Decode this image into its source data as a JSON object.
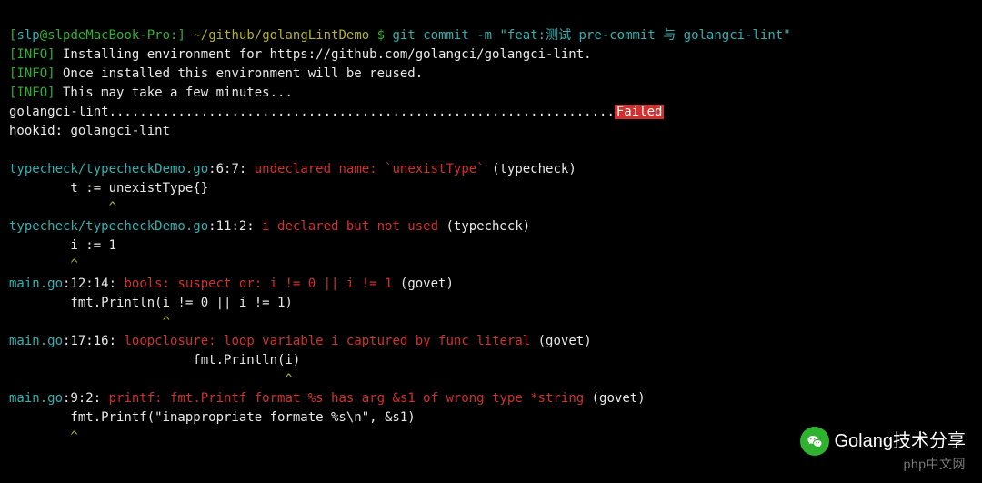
{
  "prompt": {
    "bracket_open": "[",
    "user": "slp",
    "at": "@",
    "host": "slpdeMacBook-Pro:",
    "bracket_close": "]",
    "cwd": " ~/github/golangLintDemo ",
    "dollar": "$",
    "command": " git commit -m \"feat:测试 pre-commit 与 golangci-lint\""
  },
  "info": {
    "tag": "[INFO]",
    "line1": " Installing environment for https://github.com/golangci/golangci-lint.",
    "line2": " Once installed this environment will be reused.",
    "line3": " This may take a few minutes..."
  },
  "hook": {
    "name": "golangci-lint",
    "dots": "..................................................................",
    "status": "Failed",
    "hookid_label": "hookid: ",
    "hookid_value": "golangci-lint"
  },
  "blank": " ",
  "errors": [
    {
      "file": "typecheck/typecheckDemo.go",
      "loc": ":6:7:",
      "msg": " undeclared name: `unexistType`",
      "suffix": " (typecheck)",
      "code": "        t := unexistType{}",
      "caret": "             ^"
    },
    {
      "file": "typecheck/typecheckDemo.go",
      "loc": ":11:2:",
      "msg": " i declared but not used",
      "suffix": " (typecheck)",
      "code": "        i := 1",
      "caret": "        ^"
    },
    {
      "file": "main.go",
      "loc": ":12:14:",
      "msg": " bools: suspect or: i != 0 || i != 1",
      "suffix": " (govet)",
      "code": "        fmt.Println(i != 0 || i != 1)",
      "caret": "                    ^"
    },
    {
      "file": "main.go",
      "loc": ":17:16:",
      "msg": " loopclosure: loop variable i captured by func literal",
      "suffix": " (govet)",
      "code": "                        fmt.Println(i)",
      "caret": "                                    ^"
    },
    {
      "file": "main.go",
      "loc": ":9:2:",
      "msg": " printf: fmt.Printf format %s has arg &s1 of wrong type *string",
      "suffix": " (govet)",
      "code": "        fmt.Printf(\"inappropriate formate %s\\n\", &s1)",
      "caret": "        ^"
    }
  ],
  "watermark": {
    "text": "Golang技术分享",
    "phpcn": "php中文网"
  }
}
